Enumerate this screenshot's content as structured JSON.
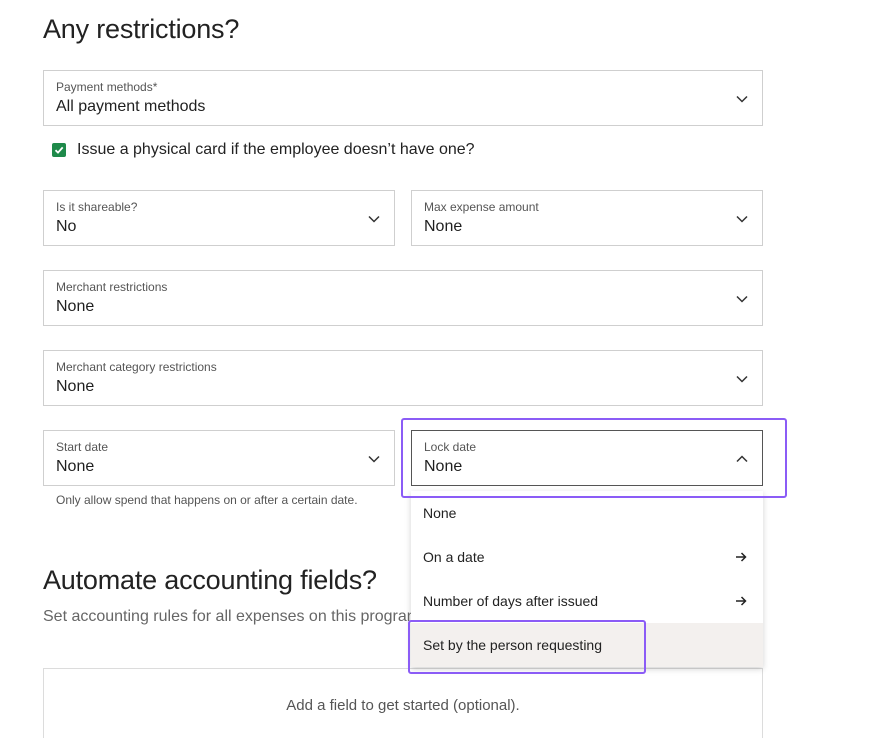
{
  "restrictions": {
    "heading": "Any restrictions?",
    "payment_methods": {
      "label": "Payment methods*",
      "value": "All payment methods"
    },
    "physical_card": {
      "label": "Issue a physical card if the employee doesn’t have one?",
      "checked": true
    },
    "shareable": {
      "label": "Is it shareable?",
      "value": "No"
    },
    "max_expense": {
      "label": "Max expense amount",
      "value": "None"
    },
    "merchant": {
      "label": "Merchant restrictions",
      "value": "None"
    },
    "merchant_category": {
      "label": "Merchant category restrictions",
      "value": "None"
    },
    "start_date": {
      "label": "Start date",
      "value": "None",
      "helper": "Only allow spend that happens on or after a certain date."
    },
    "lock_date": {
      "label": "Lock date",
      "value": "None",
      "options": [
        {
          "label": "None",
          "has_submenu": false
        },
        {
          "label": "On a date",
          "has_submenu": true
        },
        {
          "label": "Number of days after issued",
          "has_submenu": true
        },
        {
          "label": "Set by the person requesting",
          "has_submenu": false,
          "hovered": true
        }
      ]
    }
  },
  "accounting": {
    "heading": "Automate accounting fields?",
    "subtext": "Set accounting rules for all expenses on this program",
    "placeholder": "Add a field to get started (optional)."
  },
  "colors": {
    "accent": "#8b5cf6",
    "checkbox": "#1e8a4a"
  }
}
